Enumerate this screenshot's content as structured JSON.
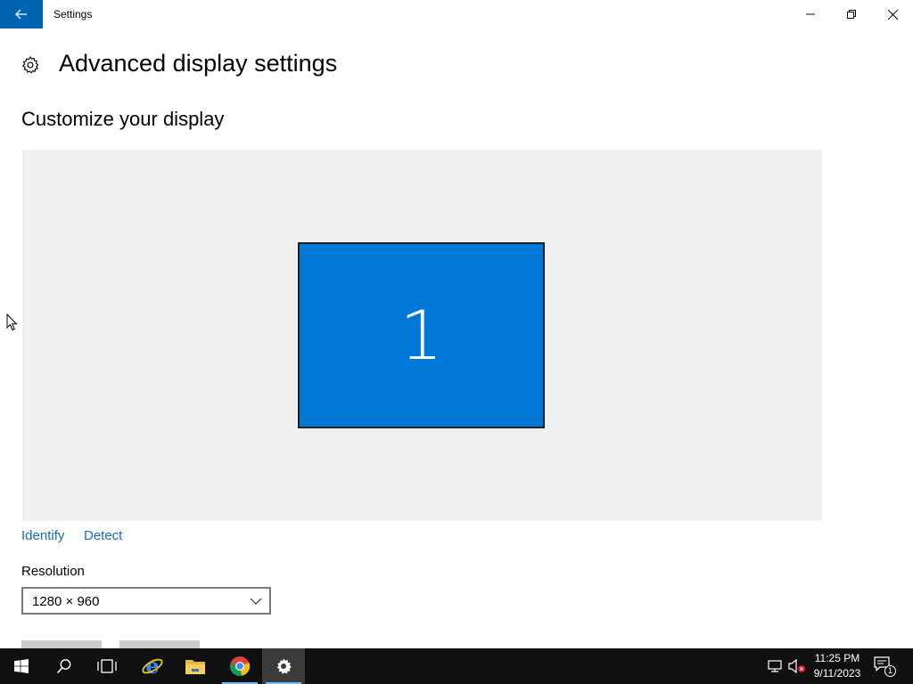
{
  "window": {
    "title": "Settings",
    "controls": {
      "minimize": "minimize-icon",
      "restore": "restore-icon",
      "close": "close-icon"
    }
  },
  "page": {
    "icon": "gear-icon",
    "title": "Advanced display settings",
    "section_title": "Customize your display"
  },
  "display_area": {
    "monitor_number": "1",
    "monitor_color": "#0078d7"
  },
  "links": {
    "identify": "Identify",
    "detect": "Detect"
  },
  "resolution": {
    "label": "Resolution",
    "value": "1280 × 960"
  },
  "taskbar": {
    "items": [
      "windows-start-icon",
      "search-icon",
      "task-view-icon",
      "internet-explorer-icon",
      "file-explorer-icon",
      "chrome-icon",
      "settings-icon"
    ],
    "active_item": "settings-icon",
    "clock": {
      "time": "11:25 PM",
      "date": "9/11/2023"
    },
    "notification_count": "1"
  },
  "colors": {
    "accent": "#0063b1",
    "link": "#1a6ab8",
    "taskbar": "#101010"
  }
}
